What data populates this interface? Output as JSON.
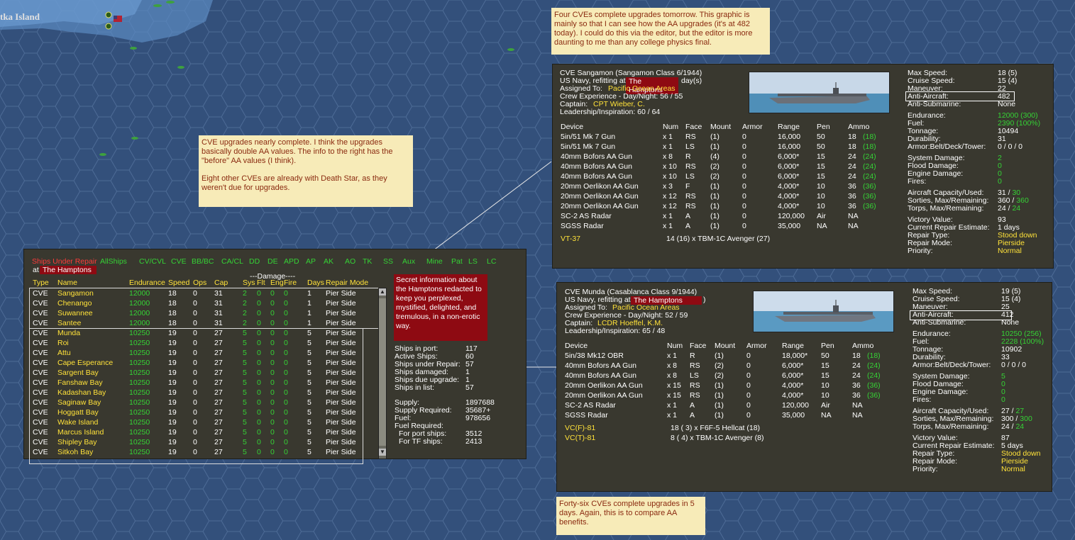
{
  "map": {
    "island_label": "tka Island"
  },
  "notes": {
    "top": "Four CVEs complete upgrades tomorrow.  This graphic is mainly so that I can see how the AA upgrades (it's at 482 today).  I could do this via the editor, but the editor is more daunting to me than any college physics final.",
    "middle_p1": "CVE upgrades nearly complete. I think the upgrades basically double AA values.  The info to the right has the \"before\" AA values (I think).",
    "middle_p2": "Eight other CVEs are already with Death Star, as they weren't due for upgrades.",
    "bottom": "Forty-six CVEs complete upgrades in 5 days.  Again, this is to compare AA benefits."
  },
  "repair_list": {
    "tabs": [
      "Ships Under Repair",
      "AllShips",
      "CV/CVL",
      "CVE",
      "BB/BC",
      "CA/CL",
      "DD",
      "DE",
      "APD",
      "AP",
      "AK",
      "AO",
      "TK",
      "SS",
      "Aux",
      "Mine",
      "Pat",
      "LS",
      "LC"
    ],
    "at_label": "at",
    "location": "The Hamptons",
    "damage_header": "---Damage----",
    "columns": [
      "Type",
      "Name",
      "Endurance",
      "Speed",
      "Ops",
      "Cap",
      "Sys",
      "Flt",
      "Eng",
      "Fire",
      "Days",
      "Repair Mode"
    ],
    "rows": [
      [
        "CVE",
        "Sangamon",
        "12000",
        "18",
        "0",
        "31",
        "2",
        "0",
        "0",
        "0",
        "1",
        "Pier Side"
      ],
      [
        "CVE",
        "Chenango",
        "12000",
        "18",
        "0",
        "31",
        "2",
        "0",
        "0",
        "0",
        "1",
        "Pier Side"
      ],
      [
        "CVE",
        "Suwannee",
        "12000",
        "18",
        "0",
        "31",
        "2",
        "0",
        "0",
        "0",
        "1",
        "Pier Side"
      ],
      [
        "CVE",
        "Santee",
        "12000",
        "18",
        "0",
        "31",
        "2",
        "0",
        "0",
        "0",
        "1",
        "Pier Side"
      ],
      [
        "CVE",
        "Munda",
        "10250",
        "19",
        "0",
        "27",
        "5",
        "0",
        "0",
        "0",
        "5",
        "Pier Side"
      ],
      [
        "CVE",
        "Roi",
        "10250",
        "19",
        "0",
        "27",
        "5",
        "0",
        "0",
        "0",
        "5",
        "Pier Side"
      ],
      [
        "CVE",
        "Attu",
        "10250",
        "19",
        "0",
        "27",
        "5",
        "0",
        "0",
        "0",
        "5",
        "Pier Side"
      ],
      [
        "CVE",
        "Cape Esperance",
        "10250",
        "19",
        "0",
        "27",
        "5",
        "0",
        "0",
        "0",
        "5",
        "Pier Side"
      ],
      [
        "CVE",
        "Sargent Bay",
        "10250",
        "19",
        "0",
        "27",
        "5",
        "0",
        "0",
        "0",
        "5",
        "Pier Side"
      ],
      [
        "CVE",
        "Fanshaw Bay",
        "10250",
        "19",
        "0",
        "27",
        "5",
        "0",
        "0",
        "0",
        "5",
        "Pier Side"
      ],
      [
        "CVE",
        "Kadashan Bay",
        "10250",
        "19",
        "0",
        "27",
        "5",
        "0",
        "0",
        "0",
        "5",
        "Pier Side"
      ],
      [
        "CVE",
        "Saginaw Bay",
        "10250",
        "19",
        "0",
        "27",
        "5",
        "0",
        "0",
        "0",
        "5",
        "Pier Side"
      ],
      [
        "CVE",
        "Hoggatt Bay",
        "10250",
        "19",
        "0",
        "27",
        "5",
        "0",
        "0",
        "0",
        "5",
        "Pier Side"
      ],
      [
        "CVE",
        "Wake Island",
        "10250",
        "19",
        "0",
        "27",
        "5",
        "0",
        "0",
        "0",
        "5",
        "Pier Side"
      ],
      [
        "CVE",
        "Marcus Island",
        "10250",
        "19",
        "0",
        "27",
        "5",
        "0",
        "0",
        "0",
        "5",
        "Pier Side"
      ],
      [
        "CVE",
        "Shipley Bay",
        "10250",
        "19",
        "0",
        "27",
        "5",
        "0",
        "0",
        "0",
        "5",
        "Pier Side"
      ],
      [
        "CVE",
        "Sitkoh Bay",
        "10250",
        "19",
        "0",
        "27",
        "5",
        "0",
        "0",
        "0",
        "5",
        "Pier Side"
      ]
    ],
    "secret": "Secret information about the Hamptons redacted to keep you perplexed, mystified, delighted, and tremulous, in a non-erotic way.",
    "stats": [
      [
        "Ships in port:",
        "117"
      ],
      [
        "Active Ships:",
        "60"
      ],
      [
        "Ships under Repair:",
        "57"
      ],
      [
        "Ships damaged:",
        "1"
      ],
      [
        "Ships due upgrade:",
        "1"
      ],
      [
        "Ships in list:",
        "57"
      ]
    ],
    "supply": [
      [
        "Supply:",
        "1897688"
      ],
      [
        "Supply Required:",
        "35687+"
      ],
      [
        "Fuel:",
        "978656"
      ],
      [
        "Fuel Required:",
        ""
      ],
      [
        "For port ships:",
        "3512"
      ],
      [
        "For TF ships:",
        "2413"
      ]
    ]
  },
  "ship1": {
    "title": "CVE Sangamon (Sangamon Class 6/1944)",
    "line2_pre": "US Navy, refitting at",
    "location": "The Hamptons",
    "line2_post": "day(s)",
    "assigned_label": "Assigned To:",
    "assigned_value": "Pacific Ocean Areas",
    "crew": "Crew Experience - Day/Night: 56 / 55",
    "captain_label": "Captain:",
    "captain_value": "CPT Wieber, C.",
    "leadership": "Leadership/Inspiration: 60 / 64",
    "weapon_headers": [
      "Device",
      "Num",
      "Face",
      "Mount",
      "Armor",
      "Range",
      "Pen",
      "Ammo"
    ],
    "weapons": [
      [
        "5in/51 Mk 7 Gun",
        "x 1",
        "RS",
        "(1)",
        "0",
        "16,000",
        "50",
        "18",
        "(18)"
      ],
      [
        "5in/51 Mk 7 Gun",
        "x 1",
        "LS",
        "(1)",
        "0",
        "16,000",
        "50",
        "18",
        "(18)"
      ],
      [
        "40mm Bofors AA Gun",
        "x 8",
        "R",
        "(4)",
        "0",
        "6,000*",
        "15",
        "24",
        "(24)"
      ],
      [
        "40mm Bofors AA Gun",
        "x 10",
        "RS",
        "(2)",
        "0",
        "6,000*",
        "15",
        "24",
        "(24)"
      ],
      [
        "40mm Bofors AA Gun",
        "x 10",
        "LS",
        "(2)",
        "0",
        "6,000*",
        "15",
        "24",
        "(24)"
      ],
      [
        "20mm Oerlikon AA Gun",
        "x 3",
        "F",
        "(1)",
        "0",
        "4,000*",
        "10",
        "36",
        "(36)"
      ],
      [
        "20mm Oerlikon AA Gun",
        "x 12",
        "RS",
        "(1)",
        "0",
        "4,000*",
        "10",
        "36",
        "(36)"
      ],
      [
        "20mm Oerlikon AA Gun",
        "x 12",
        "RS",
        "(1)",
        "0",
        "4,000*",
        "10",
        "36",
        "(36)"
      ],
      [
        "SC-2 AS Radar",
        "x 1",
        "A",
        "(1)",
        "0",
        "120,000",
        "Air",
        "NA",
        ""
      ],
      [
        "SGSS Radar",
        "x 1",
        "A",
        "(1)",
        "0",
        "35,000",
        "NA",
        "NA",
        ""
      ]
    ],
    "air": [
      [
        "VT-37",
        "14 (16) x TBM-1C Avenger (27)"
      ]
    ],
    "specs": [
      [
        "Max Speed:",
        "18 (5)",
        "w"
      ],
      [
        "Cruise Speed:",
        "15 (4)",
        "w"
      ],
      [
        "Maneuver:",
        "22",
        "w"
      ],
      [
        "Anti-Aircraft:",
        "482",
        "w"
      ],
      [
        "Anti-Submarine:",
        "None",
        "w"
      ],
      [
        "",
        "",
        ""
      ],
      [
        "Endurance:",
        "12000 (300)",
        "g"
      ],
      [
        "Fuel:",
        "2390 (100%)",
        "g"
      ],
      [
        "Tonnage:",
        "10494",
        "w"
      ],
      [
        "Durability:",
        "31",
        "w"
      ],
      [
        "Armor:Belt/Deck/Tower:",
        "0 / 0 / 0",
        "w"
      ],
      [
        "",
        "",
        ""
      ],
      [
        "System Damage:",
        "2",
        "g"
      ],
      [
        "Flood Damage:",
        "0",
        "g"
      ],
      [
        "Engine Damage:",
        "0",
        "g"
      ],
      [
        "Fires:",
        "0",
        "g"
      ],
      [
        "",
        "",
        ""
      ],
      [
        "Aircraft Capacity/Used:",
        "31 / 30",
        "w"
      ],
      [
        "Sorties, Max/Remaining:",
        "360 / 360",
        "w"
      ],
      [
        "Torps, Max/Remaining:",
        "24 / 24",
        "w"
      ],
      [
        "",
        "",
        ""
      ],
      [
        "Victory Value:",
        "93",
        "w"
      ],
      [
        "Current Repair Estimate:",
        "1 days",
        "w"
      ],
      [
        "Repair Type:",
        "Stood down",
        "y"
      ],
      [
        "Repair Mode:",
        "Pierside",
        "y"
      ],
      [
        "Priority:",
        "Normal",
        "y"
      ]
    ]
  },
  "ship2": {
    "title": "CVE Munda (Casablanca Class 9/1944)",
    "line2_pre": "US Navy, refitting at",
    "location": "The Hamptons",
    "line2_post": ")",
    "assigned_label": "Assigned To:",
    "assigned_value": "Pacific Ocean Areas",
    "crew": "Crew Experience - Day/Night: 52 / 59",
    "captain_label": "Captain:",
    "captain_value": "LCDR Hoeffel, K.M.",
    "leadership": "Leadership/Inspiration: 65 / 48",
    "weapon_headers": [
      "Device",
      "Num",
      "Face",
      "Mount",
      "Armor",
      "Range",
      "Pen",
      "Ammo"
    ],
    "weapons": [
      [
        "5in/38 Mk12 OBR",
        "x 1",
        "R",
        "(1)",
        "0",
        "18,000*",
        "50",
        "18",
        "(18)"
      ],
      [
        "40mm Bofors AA Gun",
        "x 8",
        "RS",
        "(2)",
        "0",
        "6,000*",
        "15",
        "24",
        "(24)"
      ],
      [
        "40mm Bofors AA Gun",
        "x 8",
        "LS",
        "(2)",
        "0",
        "6,000*",
        "15",
        "24",
        "(24)"
      ],
      [
        "20mm Oerlikon AA Gun",
        "x 15",
        "RS",
        "(1)",
        "0",
        "4,000*",
        "10",
        "36",
        "(36)"
      ],
      [
        "20mm Oerlikon AA Gun",
        "x 15",
        "RS",
        "(1)",
        "0",
        "4,000*",
        "10",
        "36",
        "(36)"
      ],
      [
        "SC-2 AS Radar",
        "x 1",
        "A",
        "(1)",
        "0",
        "120,000",
        "Air",
        "NA",
        ""
      ],
      [
        "SGSS Radar",
        "x 1",
        "A",
        "(1)",
        "0",
        "35,000",
        "NA",
        "NA",
        ""
      ]
    ],
    "air": [
      [
        "VC(F)-81",
        "18 ( 3) x F6F-5 Hellcat (18)"
      ],
      [
        "VC(T)-81",
        "8 ( 4) x TBM-1C Avenger (8)"
      ]
    ],
    "specs": [
      [
        "Max Speed:",
        "19 (5)",
        "w"
      ],
      [
        "Cruise Speed:",
        "15 (4)",
        "w"
      ],
      [
        "Maneuver:",
        "25",
        "w"
      ],
      [
        "Anti-Aircraft:",
        "412",
        "w"
      ],
      [
        "Anti-Submarine:",
        "None",
        "w"
      ],
      [
        "",
        "",
        ""
      ],
      [
        "Endurance:",
        "10250 (256)",
        "g"
      ],
      [
        "Fuel:",
        "2228 (100%)",
        "g"
      ],
      [
        "Tonnage:",
        "10902",
        "w"
      ],
      [
        "Durability:",
        "33",
        "w"
      ],
      [
        "Armor:Belt/Deck/Tower:",
        "0 / 0 / 0",
        "w"
      ],
      [
        "",
        "",
        ""
      ],
      [
        "System Damage:",
        "5",
        "g"
      ],
      [
        "Flood Damage:",
        "0",
        "g"
      ],
      [
        "Engine Damage:",
        "0",
        "g"
      ],
      [
        "Fires:",
        "0",
        "g"
      ],
      [
        "",
        "",
        ""
      ],
      [
        "Aircraft Capacity/Used:",
        "27 / 27",
        "w"
      ],
      [
        "Sorties, Max/Remaining:",
        "300 / 300",
        "w"
      ],
      [
        "Torps, Max/Remaining:",
        "24 / 24",
        "w"
      ],
      [
        "",
        "",
        ""
      ],
      [
        "Victory Value:",
        "87",
        "w"
      ],
      [
        "Current Repair Estimate:",
        "5 days",
        "w"
      ],
      [
        "Repair Type:",
        "Stood down",
        "y"
      ],
      [
        "Repair Mode:",
        "Pierside",
        "y"
      ],
      [
        "Priority:",
        "Normal",
        "y"
      ]
    ]
  }
}
